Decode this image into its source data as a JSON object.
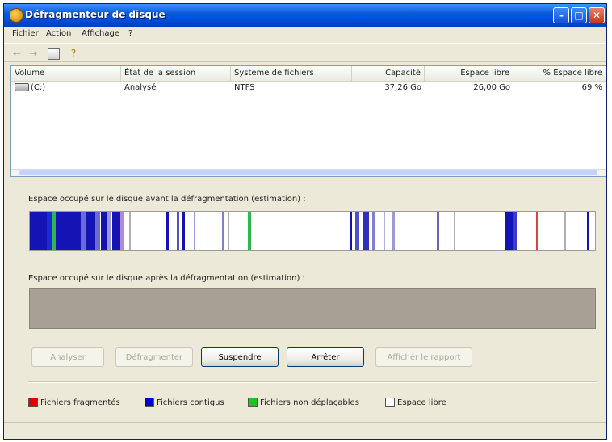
{
  "window": {
    "title": "Défragmenteur de disque",
    "controls": {
      "minimize": "–",
      "maximize": "□",
      "close": "✕"
    }
  },
  "menu": [
    "Fichier",
    "Action",
    "Affichage",
    "?"
  ],
  "toolbar": {
    "back": "←",
    "forward": "→",
    "view": "",
    "help": "?"
  },
  "volumes": {
    "columns": [
      "Volume",
      "État de la session",
      "Système de fichiers",
      "Capacité",
      "Espace libre",
      "% Espace libre"
    ],
    "rows": [
      {
        "volume": "(C:)",
        "state": "Analysé",
        "fs": "NTFS",
        "capacity": "37,26 Go",
        "free": "26,00 Go",
        "pct": "69 %"
      }
    ]
  },
  "before": {
    "label": "Espace occupé sur le disque avant la défragmentation (estimation) :",
    "segments": [
      {
        "s": 0.0,
        "e": 0.03,
        "c": "#1414b4"
      },
      {
        "s": 0.03,
        "e": 0.04,
        "c": "#1a2ad8"
      },
      {
        "s": 0.04,
        "e": 0.046,
        "c": "#2fb84a"
      },
      {
        "s": 0.046,
        "e": 0.09,
        "c": "#1414b4"
      },
      {
        "s": 0.09,
        "e": 0.1,
        "c": "#6a6ad8"
      },
      {
        "s": 0.1,
        "e": 0.115,
        "c": "#1414b4"
      },
      {
        "s": 0.115,
        "e": 0.125,
        "c": "#6a6ad8"
      },
      {
        "s": 0.125,
        "e": 0.135,
        "c": "#1414b4"
      },
      {
        "s": 0.135,
        "e": 0.145,
        "c": "#9a9ad8"
      },
      {
        "s": 0.145,
        "e": 0.16,
        "c": "#1414b4"
      },
      {
        "s": 0.16,
        "e": 0.165,
        "c": "#b08ad0"
      },
      {
        "s": 0.175,
        "e": 0.178,
        "c": "#b0b0b0"
      },
      {
        "s": 0.24,
        "e": 0.245,
        "c": "#1414b4"
      },
      {
        "s": 0.26,
        "e": 0.264,
        "c": "#5050c8"
      },
      {
        "s": 0.27,
        "e": 0.274,
        "c": "#1414b4"
      },
      {
        "s": 0.29,
        "e": 0.293,
        "c": "#9a9ad8"
      },
      {
        "s": 0.34,
        "e": 0.345,
        "c": "#8080d0"
      },
      {
        "s": 0.35,
        "e": 0.353,
        "c": "#b0b0b0"
      },
      {
        "s": 0.385,
        "e": 0.392,
        "c": "#2fb84a"
      },
      {
        "s": 0.565,
        "e": 0.57,
        "c": "#1414b4"
      },
      {
        "s": 0.575,
        "e": 0.583,
        "c": "#5050c8"
      },
      {
        "s": 0.588,
        "e": 0.6,
        "c": "#3030b8"
      },
      {
        "s": 0.605,
        "e": 0.61,
        "c": "#8080d0"
      },
      {
        "s": 0.625,
        "e": 0.629,
        "c": "#b0b0d8"
      },
      {
        "s": 0.64,
        "e": 0.645,
        "c": "#9a9ad8"
      },
      {
        "s": 0.72,
        "e": 0.724,
        "c": "#7060c0"
      },
      {
        "s": 0.75,
        "e": 0.753,
        "c": "#b0b0b0"
      },
      {
        "s": 0.84,
        "e": 0.855,
        "c": "#1414b4"
      },
      {
        "s": 0.855,
        "e": 0.862,
        "c": "#3a3ad0"
      },
      {
        "s": 0.895,
        "e": 0.898,
        "c": "#e04040"
      },
      {
        "s": 0.945,
        "e": 0.948,
        "c": "#b0b0b0"
      },
      {
        "s": 0.985,
        "e": 0.99,
        "c": "#1414b4"
      }
    ]
  },
  "after": {
    "label": "Espace occupé sur le disque après la défragmentation (estimation) :"
  },
  "buttons": {
    "analyze": "Analyser",
    "defrag": "Défragmenter",
    "pause": "Suspendre",
    "stop": "Arrêter",
    "report": "Afficher le rapport"
  },
  "legend": [
    {
      "label": "Fichiers fragmentés",
      "color": "#e00000"
    },
    {
      "label": "Fichiers contigus",
      "color": "#0000c8"
    },
    {
      "label": "Fichiers non déplaçables",
      "color": "#22c022"
    },
    {
      "label": "Espace libre",
      "color": "#ffffff"
    }
  ]
}
